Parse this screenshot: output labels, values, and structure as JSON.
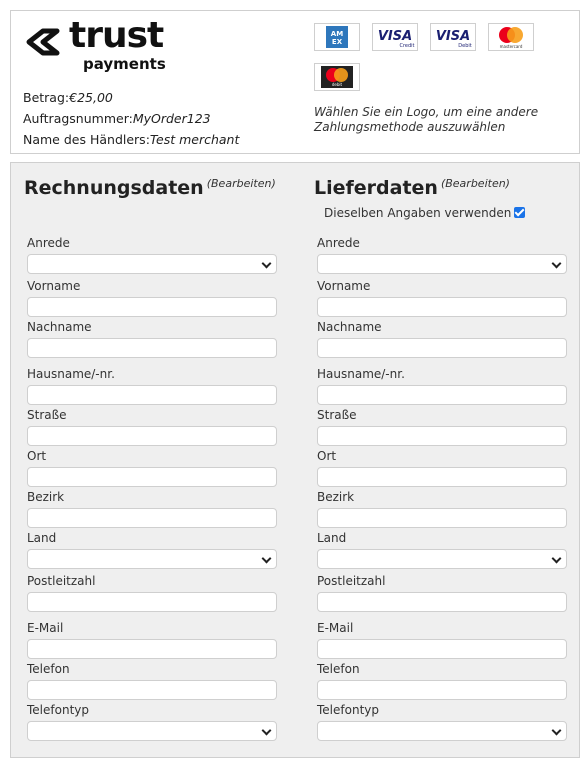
{
  "brand": {
    "name": "trust",
    "subtitle": "payments"
  },
  "order": {
    "amount_label": "Betrag:",
    "amount_value": "€25,00",
    "order_no_label": "Auftragsnummer:",
    "order_no_value": "MyOrder123",
    "merchant_label": "Name des Händlers:",
    "merchant_value": "Test merchant"
  },
  "payment_methods": {
    "logos": [
      "AMEX",
      "VISA Credit",
      "VISA Debit",
      "mastercard",
      "mastercard debit"
    ],
    "hint": "Wählen Sie ein Logo, um eine andere Zahlungsmethode auszuwählen"
  },
  "billing": {
    "title": "Rechnungsdaten",
    "edit": "(Bearbeiten)",
    "fields": [
      {
        "label": "Anrede",
        "type": "select",
        "value": ""
      },
      {
        "label": "Vorname",
        "type": "text",
        "value": ""
      },
      {
        "label": "Nachname",
        "type": "text",
        "value": ""
      },
      {
        "label": "Hausname/-nr.",
        "type": "text",
        "value": ""
      },
      {
        "label": "Straße",
        "type": "text",
        "value": ""
      },
      {
        "label": "Ort",
        "type": "text",
        "value": ""
      },
      {
        "label": "Bezirk",
        "type": "text",
        "value": ""
      },
      {
        "label": "Land",
        "type": "select",
        "value": ""
      },
      {
        "label": "Postleitzahl",
        "type": "text",
        "value": ""
      },
      {
        "label": "E-Mail",
        "type": "text",
        "value": ""
      },
      {
        "label": "Telefon",
        "type": "text",
        "value": ""
      },
      {
        "label": "Telefontyp",
        "type": "select",
        "value": ""
      }
    ]
  },
  "delivery": {
    "title": "Lieferdaten",
    "edit": "(Bearbeiten)",
    "same_as_billing_label": "Dieselben Angaben verwenden",
    "same_as_billing_checked": true,
    "fields": [
      {
        "label": "Anrede",
        "type": "select",
        "value": ""
      },
      {
        "label": "Vorname",
        "type": "text",
        "value": ""
      },
      {
        "label": "Nachname",
        "type": "text",
        "value": ""
      },
      {
        "label": "Hausname/-nr.",
        "type": "text",
        "value": ""
      },
      {
        "label": "Straße",
        "type": "text",
        "value": ""
      },
      {
        "label": "Ort",
        "type": "text",
        "value": ""
      },
      {
        "label": "Bezirk",
        "type": "text",
        "value": ""
      },
      {
        "label": "Land",
        "type": "select",
        "value": ""
      },
      {
        "label": "Postleitzahl",
        "type": "text",
        "value": ""
      },
      {
        "label": "E-Mail",
        "type": "text",
        "value": ""
      },
      {
        "label": "Telefon",
        "type": "text",
        "value": ""
      },
      {
        "label": "Telefontyp",
        "type": "select",
        "value": ""
      }
    ]
  },
  "colors": {
    "panel_bg": "#efefef",
    "border": "#cfcfcf",
    "checkbox": "#1a73e8",
    "visa_blue": "#1a1f71",
    "amex_blue": "#2e77bc",
    "mc_red": "#eb001b",
    "mc_orange": "#f79e1b"
  }
}
